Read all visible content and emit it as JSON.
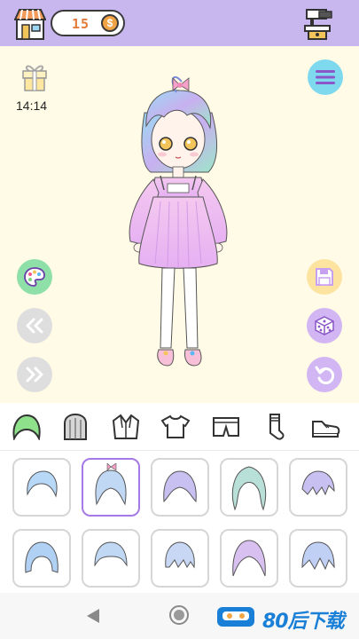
{
  "header": {
    "coins": "15",
    "coin_symbol": "$"
  },
  "stage": {
    "timer": "14:14"
  },
  "categories": [
    "hair-front",
    "hair-back",
    "jacket",
    "top",
    "bottoms",
    "socks",
    "shoes"
  ],
  "selected_category": "hair-front",
  "items": {
    "count": 10,
    "selected_index": 1
  },
  "watermark": {
    "text": "80后下载"
  },
  "colors": {
    "topbar": "#c8b6ee",
    "stage_bg": "#fffbe6",
    "selected_border": "#a67ae6",
    "coin_text": "#e27a3a",
    "watermark_blue": "#1a7fd6"
  }
}
